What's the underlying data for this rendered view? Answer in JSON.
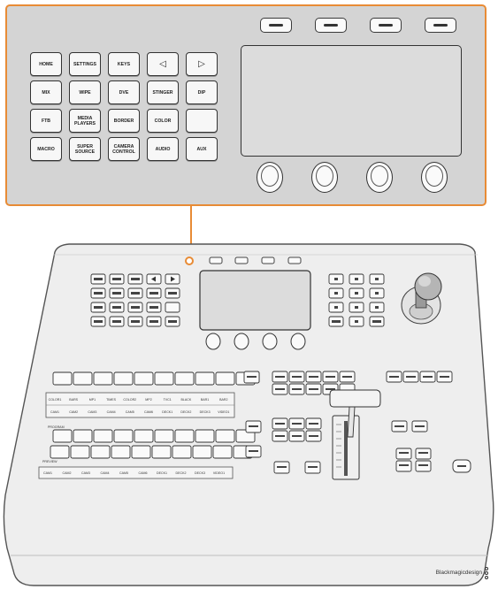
{
  "callout": {
    "row1": [
      "HOME",
      "SETTINGS",
      "KEYS",
      "◁",
      "▷"
    ],
    "row2": [
      "MIX",
      "WIPE",
      "DVE",
      "STINGER",
      "DIP"
    ],
    "row3": [
      "FTB",
      "MEDIA PLAYERS",
      "BORDER",
      "COLOR",
      ""
    ],
    "row4": [
      "MACRO",
      "SUPER SOURCE",
      "CAMERA CONTROL",
      "AUDIO",
      "AUX"
    ]
  },
  "console": {
    "source_row_top": [
      "COLOR1",
      "BARS",
      "MP1",
      "TIMES",
      "COLOR2",
      "MP2",
      "TVC1",
      "BLACK",
      "BAR1",
      "BAR2"
    ],
    "source_row_bottom": [
      "CAM1",
      "CAM2",
      "CAM3",
      "CAM4",
      "CAM5",
      "CAM6",
      "DECK1",
      "DECK2",
      "DECK3",
      "VIDEO1"
    ],
    "program_label": "PROGRAM",
    "preview_label": "PREVIEW",
    "preview_row": [
      "CAM1",
      "CAM2",
      "CAM3",
      "CAM4",
      "CAM5",
      "CAM6",
      "DECK1",
      "DECK2",
      "DECK3",
      "VIDEO1"
    ],
    "brand": "Blackmagicdesign"
  },
  "colors": {
    "callout_border": "#e88b35",
    "panel": "#d4d4d4",
    "key_face": "#f7f7f7"
  }
}
